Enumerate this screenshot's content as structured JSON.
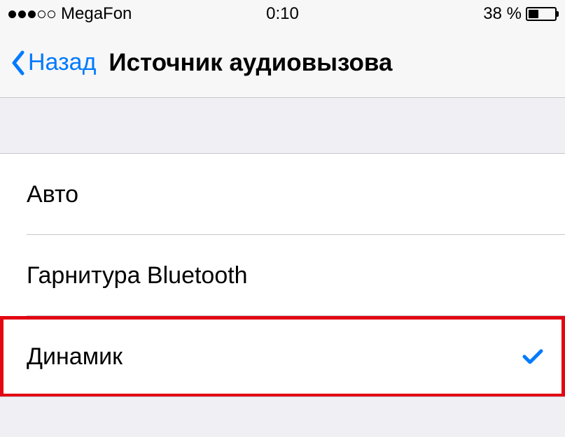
{
  "status": {
    "carrier": "MegaFon",
    "time": "0:10",
    "battery_pct": "38 %",
    "battery_level": 38,
    "signal_filled": 3,
    "signal_total": 5
  },
  "nav": {
    "back_label": "Назад",
    "title": "Источник аудиовызова"
  },
  "list": {
    "items": [
      {
        "label": "Авто",
        "selected": false,
        "highlighted": false
      },
      {
        "label": "Гарнитура Bluetooth",
        "selected": false,
        "highlighted": false
      },
      {
        "label": "Динамик",
        "selected": true,
        "highlighted": true
      }
    ]
  },
  "colors": {
    "accent": "#007aff",
    "highlight": "#e30613"
  }
}
